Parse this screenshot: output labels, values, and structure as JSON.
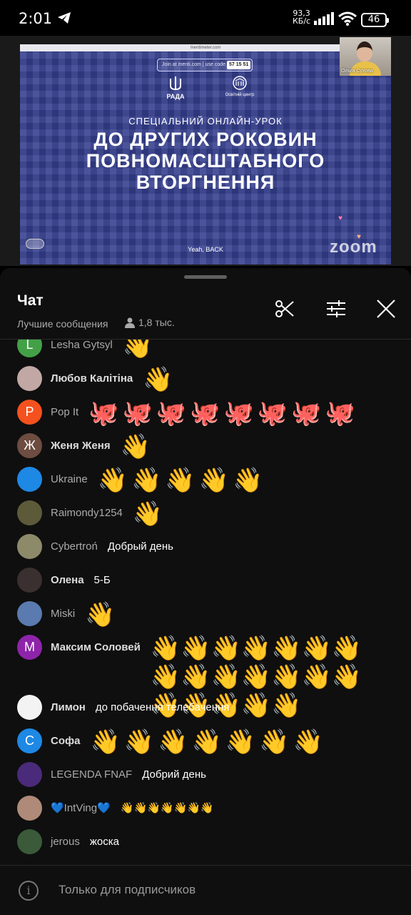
{
  "status_bar": {
    "time": "2:01",
    "net_speed": "93,3",
    "net_unit": "КБ/с",
    "battery": "46"
  },
  "video": {
    "url": "menti​meter.com",
    "join_text": "Join at menti.com | use code",
    "join_code": "57 15 51",
    "logo_left": "РАДА",
    "logo_right": "Освітній центр",
    "subtitle": "СПЕЦІАЛЬНИЙ ОНЛАЙН-УРОК",
    "headline_1": "ДО ДРУГИХ РОКОВИН",
    "headline_2": "ПОВНОМАСШТАБНОГО",
    "headline_3": "ВТОРГНЕННЯ",
    "caption": "Yeah, BACK",
    "watermark": "zoom",
    "camera_name": "Ольга Сухова"
  },
  "chat": {
    "title": "Чат",
    "mode": "Лучшие сообщения",
    "viewers": "1,8 тыс.",
    "messages": [
      {
        "author": "Lesha Gytsyl",
        "initial": "L",
        "avatar_color": "#43a047",
        "text": "",
        "emoji": "👋",
        "count": 1
      },
      {
        "author": "Любов Калітіна",
        "initial": "",
        "avatar_color": "#c2a8a4",
        "member": true,
        "text": "",
        "emoji": "👋",
        "count": 1
      },
      {
        "author": "Pop It",
        "initial": "P",
        "avatar_color": "#f4511e",
        "text": "",
        "emoji": "🐙",
        "count": 8
      },
      {
        "author": "Женя Женя",
        "initial": "Ж",
        "avatar_color": "#6d4c41",
        "member": true,
        "text": "",
        "emoji": "👋",
        "count": 1
      },
      {
        "author": "Ukraine",
        "initial": "",
        "avatar_color": "#1e88e5",
        "text": "",
        "emoji": "👋",
        "count": 5
      },
      {
        "author": "Raimondy1254",
        "initial": "",
        "avatar_color": "#5d5a3a",
        "text": "",
        "emoji": "👋",
        "count": 1
      },
      {
        "author": "Cybertroń",
        "initial": "",
        "avatar_color": "#8d8a6a",
        "text": "Добрый день",
        "emoji": "",
        "count": 0
      },
      {
        "author": "Олена",
        "initial": "",
        "avatar_color": "#3a3030",
        "member": true,
        "text": "5-Б",
        "emoji": "",
        "count": 0
      },
      {
        "author": "Miski",
        "initial": "",
        "avatar_color": "#5a7ab0",
        "text": "",
        "emoji": "👋",
        "count": 1
      },
      {
        "author": "Максим Соловей",
        "initial": "M",
        "avatar_color": "#8e24aa",
        "member": true,
        "text": "",
        "emoji": "👋",
        "count": 19
      },
      {
        "author": "Лимон",
        "initial": "",
        "avatar_color": "#f3f3f3",
        "member": true,
        "text": "до побачення телебачення",
        "emoji": "",
        "count": 0
      },
      {
        "author": "Софа",
        "initial": "C",
        "avatar_color": "#1e88e5",
        "member": true,
        "text": "",
        "emoji": "👋",
        "count": 7
      },
      {
        "author": "LEGENDA FNAF",
        "initial": "",
        "avatar_color": "#4a2a7a",
        "text": "Добрий день",
        "emoji": "",
        "count": 0
      },
      {
        "author": "💙IntVing💙",
        "initial": "",
        "avatar_color": "#b08a78",
        "text": "👋👋👋👋👋👋👋",
        "emoji": "",
        "count": 0
      },
      {
        "author": "jerous",
        "initial": "",
        "avatar_color": "#3a5a3a",
        "text": "жоска",
        "emoji": "",
        "count": 0
      }
    ]
  },
  "footer": {
    "text": "Только для подписчиков"
  },
  "colors": {
    "chat_bg": "#0f0f0f",
    "slide_bg": "#36408f",
    "wave_emoji": "#ff3d8a"
  },
  "icons": [
    "telegram-icon",
    "signal-icon",
    "wifi-icon",
    "battery-icon",
    "person-icon",
    "scissors-icon",
    "tune-icon",
    "close-icon",
    "info-icon"
  ]
}
